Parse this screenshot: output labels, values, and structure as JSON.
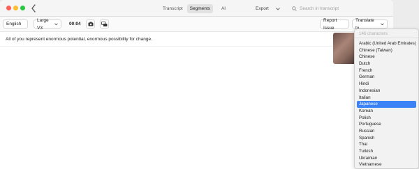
{
  "titlebar": {
    "tabs": [
      {
        "label": "Transcript",
        "active": false
      },
      {
        "label": "Segments",
        "active": true
      },
      {
        "label": "AI",
        "active": false
      }
    ],
    "export_label": "Export",
    "search_placeholder": "Search in transcript"
  },
  "toolbar": {
    "language": "English",
    "model": "Large V3",
    "time": "00:04",
    "report_issue": "Report Issue",
    "translate": "Translate to..."
  },
  "transcript": {
    "text": "All of you represent enormous potential, enormous possibility for change."
  },
  "translate_menu": {
    "header": "146 characters",
    "selected": "Japanese",
    "languages": [
      "Arabic (United Arab Emirates)",
      "Chinese (Taiwan)",
      "Chinese",
      "Dutch",
      "French",
      "German",
      "Hindi",
      "Indonesian",
      "Italian",
      "Japanese",
      "Korean",
      "Polish",
      "Portuguese",
      "Russian",
      "Spanish",
      "Thai",
      "Turkish",
      "Ukrainian",
      "Vietnamese"
    ]
  },
  "colors": {
    "accent": "#3b82f6",
    "traffic_red": "#fe5f57",
    "traffic_yellow": "#febc2e",
    "traffic_green": "#28c840"
  }
}
